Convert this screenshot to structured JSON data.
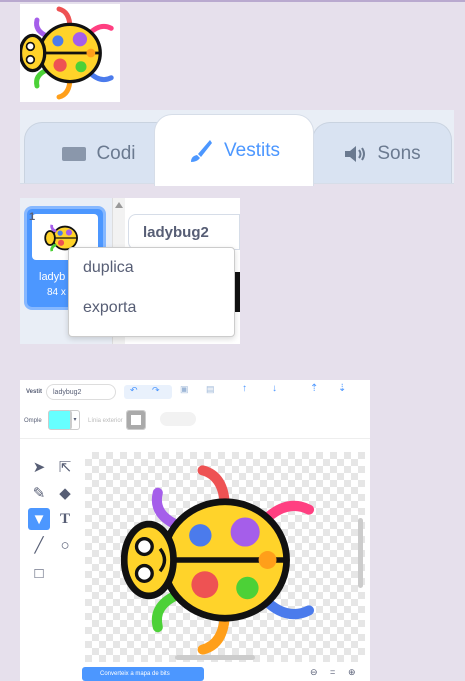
{
  "tabs": [
    {
      "label": "Codi",
      "icon": "code-icon"
    },
    {
      "label": "Vestits",
      "icon": "brush-icon"
    },
    {
      "label": "Sons",
      "icon": "speaker-icon"
    }
  ],
  "costume_list": {
    "index": "1",
    "name_partial": "ladyb",
    "size_partial": "84 x",
    "name_field": "ladybug2"
  },
  "context_menu": {
    "items": [
      "duplica",
      "exporta"
    ]
  },
  "editor": {
    "costume_label": "Vestit",
    "costume_name": "ladybug2",
    "fill_label": "Omple",
    "outline_label": "Línia exterior",
    "convert_button": "Converteix a mapa de bits",
    "fill_color": "#66ffff"
  }
}
